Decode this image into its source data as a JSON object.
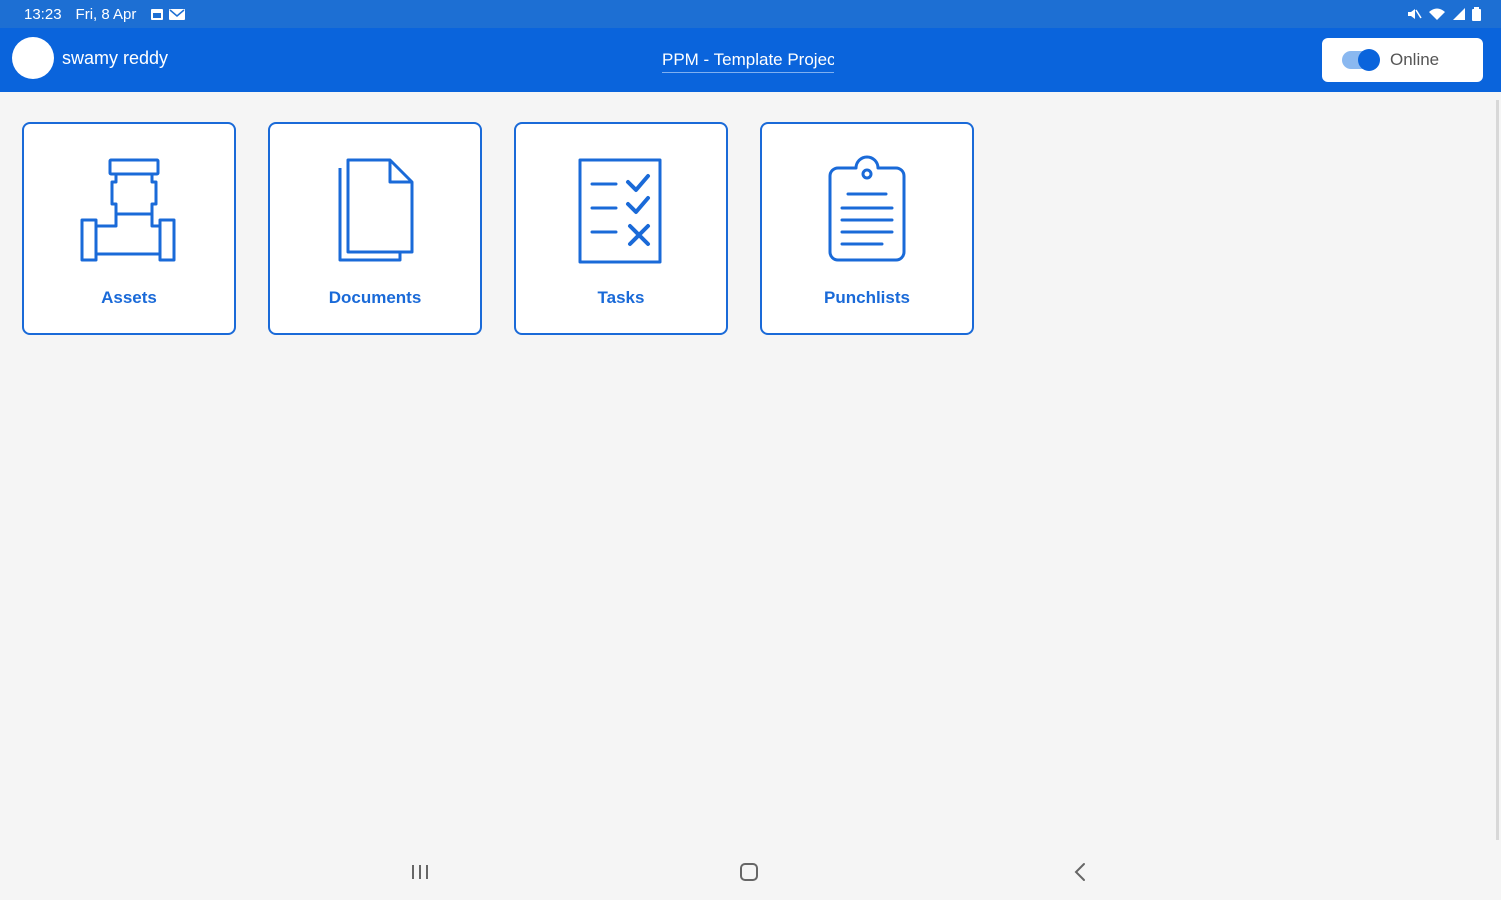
{
  "status_bar": {
    "time": "13:23",
    "date": "Fri, 8 Apr"
  },
  "app_bar": {
    "user_name": "swamy reddy",
    "project_title": "PPM - Template Project",
    "online_label": "Online",
    "online": true
  },
  "tiles": [
    {
      "label": "Assets",
      "icon": "pipe-valve-icon"
    },
    {
      "label": "Documents",
      "icon": "documents-icon"
    },
    {
      "label": "Tasks",
      "icon": "checklist-icon"
    },
    {
      "label": "Punchlists",
      "icon": "clipboard-icon"
    }
  ],
  "colors": {
    "status_bar": "#1d6fd3",
    "app_bar": "#0a64dc",
    "accent": "#1a6ad8",
    "background": "#f5f5f5"
  }
}
